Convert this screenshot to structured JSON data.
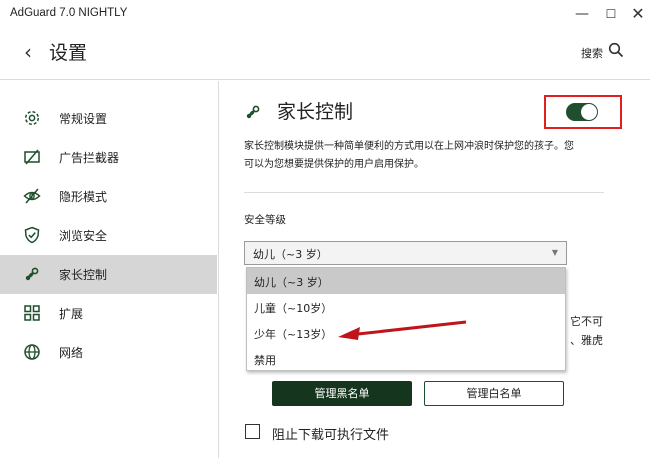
{
  "window": {
    "title": "AdGuard 7.0 NIGHTLY",
    "minimize": "—",
    "maximize": "☐",
    "close": "✕"
  },
  "header": {
    "back_icon": "‹",
    "title": "设置",
    "search_label": "搜索"
  },
  "sidebar": {
    "items": [
      {
        "label": "常规设置",
        "icon": "gear-icon"
      },
      {
        "label": "广告拦截器",
        "icon": "ad-blocker-icon"
      },
      {
        "label": "隐形模式",
        "icon": "eye-slash-icon"
      },
      {
        "label": "浏览安全",
        "icon": "shield-check-icon"
      },
      {
        "label": "家长控制",
        "icon": "pacifier-icon",
        "active": true
      },
      {
        "label": "扩展",
        "icon": "extensions-icon"
      },
      {
        "label": "网络",
        "icon": "globe-icon"
      }
    ]
  },
  "main": {
    "title": "家长控制",
    "toggle_on": true,
    "description": "家长控制模块提供一种简单便利的方式用以在上网冲浪时保护您的孩子。您可以为您想要提供保护的用户启用保护。",
    "level_label": "安全等级",
    "select_value": "幼儿（~3 岁）",
    "options": [
      "幼儿（~3 岁）",
      "儿童（~10岁）",
      "少年（~13岁）",
      "禁用"
    ],
    "peek_text_1": "它不可",
    "peek_text_2": "、雅虎",
    "blacklist_button": "管理黑名单",
    "whitelist_button": "管理白名单",
    "block_downloads_label": "阻止下载可执行文件"
  },
  "colors": {
    "accent": "#1f4f2c",
    "highlight": "#e02020",
    "annotation_arrow": "#c0141c"
  }
}
